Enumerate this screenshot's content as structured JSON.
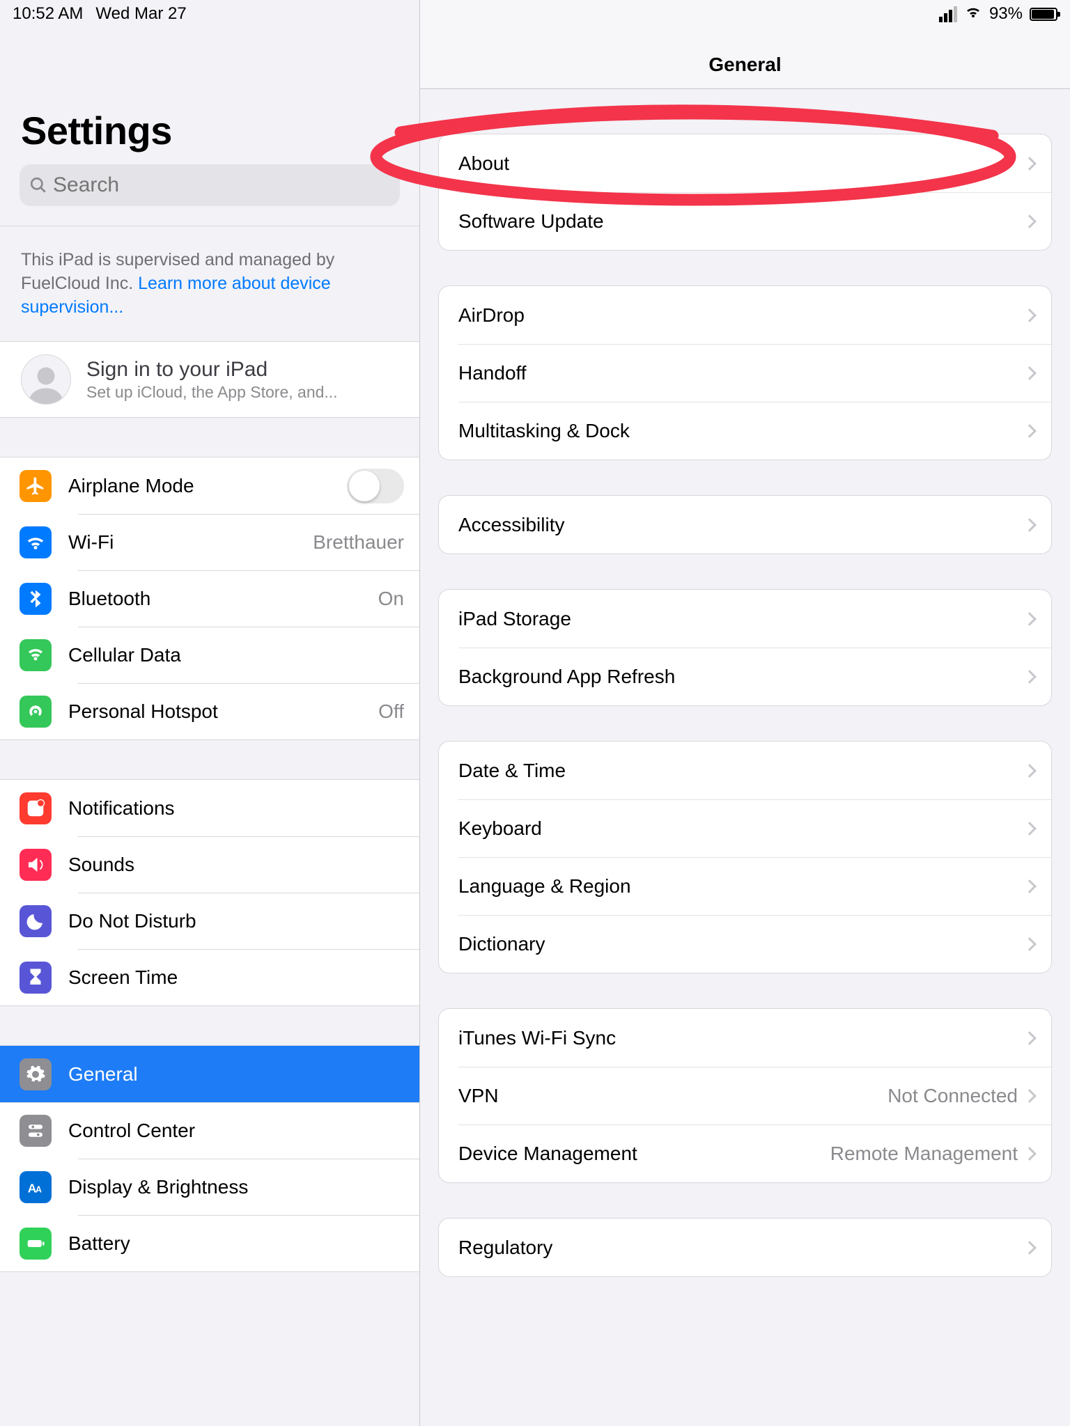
{
  "status": {
    "time": "10:52 AM",
    "date": "Wed Mar 27",
    "battery_pct": "93%"
  },
  "sidebar": {
    "title": "Settings",
    "search_placeholder": "Search",
    "supervision_text": "This iPad is supervised and managed by FuelCloud Inc. ",
    "supervision_link": "Learn more about device supervision...",
    "signin_title": "Sign in to your iPad",
    "signin_sub": "Set up iCloud, the App Store, and...",
    "items": {
      "airplane": "Airplane Mode",
      "wifi": "Wi-Fi",
      "wifi_value": "Bretthauer",
      "bluetooth": "Bluetooth",
      "bluetooth_value": "On",
      "cellular": "Cellular Data",
      "hotspot": "Personal Hotspot",
      "hotspot_value": "Off",
      "notifications": "Notifications",
      "sounds": "Sounds",
      "dnd": "Do Not Disturb",
      "screentime": "Screen Time",
      "general": "General",
      "controlcenter": "Control Center",
      "display": "Display & Brightness",
      "battery": "Battery"
    }
  },
  "detail": {
    "title": "General",
    "groups": [
      {
        "rows": [
          {
            "label": "About"
          },
          {
            "label": "Software Update"
          }
        ]
      },
      {
        "rows": [
          {
            "label": "AirDrop"
          },
          {
            "label": "Handoff"
          },
          {
            "label": "Multitasking & Dock"
          }
        ]
      },
      {
        "rows": [
          {
            "label": "Accessibility"
          }
        ]
      },
      {
        "rows": [
          {
            "label": "iPad Storage"
          },
          {
            "label": "Background App Refresh"
          }
        ]
      },
      {
        "rows": [
          {
            "label": "Date & Time"
          },
          {
            "label": "Keyboard"
          },
          {
            "label": "Language & Region"
          },
          {
            "label": "Dictionary"
          }
        ]
      },
      {
        "rows": [
          {
            "label": "iTunes Wi-Fi Sync"
          },
          {
            "label": "VPN",
            "value": "Not Connected"
          },
          {
            "label": "Device Management",
            "value": "Remote Management"
          }
        ]
      },
      {
        "rows": [
          {
            "label": "Regulatory"
          }
        ]
      }
    ]
  }
}
